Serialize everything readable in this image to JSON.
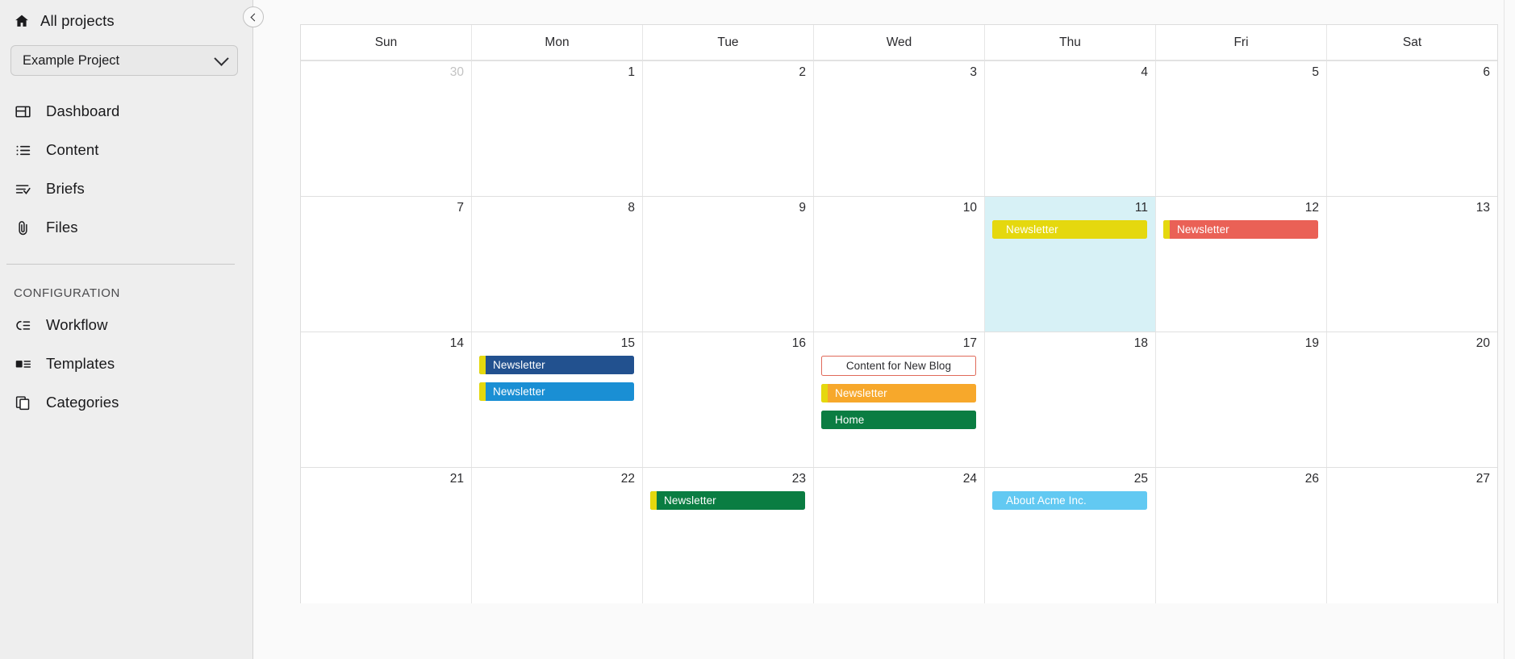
{
  "sidebar": {
    "all_projects": {
      "label": "All projects",
      "icon": "home-icon"
    },
    "project_selector": {
      "value": "Example Project",
      "icon": "chevron-down-icon"
    },
    "nav_items": [
      {
        "label": "Dashboard",
        "icon": "dashboard-icon"
      },
      {
        "label": "Content",
        "icon": "list-icon"
      },
      {
        "label": "Briefs",
        "icon": "briefs-icon"
      },
      {
        "label": "Files",
        "icon": "paperclip-icon"
      }
    ],
    "section_title": "CONFIGURATION",
    "config_items": [
      {
        "label": "Workflow",
        "icon": "workflow-icon"
      },
      {
        "label": "Templates",
        "icon": "templates-icon"
      },
      {
        "label": "Categories",
        "icon": "categories-icon"
      }
    ],
    "collapse_button": {
      "icon": "chevron-left-icon"
    }
  },
  "calendar": {
    "weekday_headers": [
      "Sun",
      "Mon",
      "Tue",
      "Wed",
      "Thu",
      "Fri",
      "Sat"
    ],
    "weeks": [
      {
        "days": [
          {
            "number": "30",
            "other_month": true,
            "today": false,
            "events": []
          },
          {
            "number": "1",
            "other_month": false,
            "today": false,
            "events": []
          },
          {
            "number": "2",
            "other_month": false,
            "today": false,
            "events": []
          },
          {
            "number": "3",
            "other_month": false,
            "today": false,
            "events": []
          },
          {
            "number": "4",
            "other_month": false,
            "today": false,
            "events": []
          },
          {
            "number": "5",
            "other_month": false,
            "today": false,
            "events": []
          },
          {
            "number": "6",
            "other_month": false,
            "today": false,
            "events": []
          }
        ]
      },
      {
        "days": [
          {
            "number": "7",
            "other_month": false,
            "today": false,
            "events": []
          },
          {
            "number": "8",
            "other_month": false,
            "today": false,
            "events": []
          },
          {
            "number": "9",
            "other_month": false,
            "today": false,
            "events": []
          },
          {
            "number": "10",
            "other_month": false,
            "today": false,
            "events": []
          },
          {
            "number": "11",
            "other_month": false,
            "today": true,
            "events": [
              {
                "title": "Newsletter",
                "style": "filled",
                "bg": "#e5d80e",
                "accent": null,
                "text": "#ffffff"
              }
            ]
          },
          {
            "number": "12",
            "other_month": false,
            "today": false,
            "events": [
              {
                "title": "Newsletter",
                "style": "filled",
                "bg": "#ea6156",
                "accent": "#e5d80e",
                "text": "#ffffff"
              }
            ]
          },
          {
            "number": "13",
            "other_month": false,
            "today": false,
            "events": []
          }
        ]
      },
      {
        "days": [
          {
            "number": "14",
            "other_month": false,
            "today": false,
            "events": []
          },
          {
            "number": "15",
            "other_month": false,
            "today": false,
            "events": [
              {
                "title": "Newsletter",
                "style": "filled",
                "bg": "#22518f",
                "accent": "#e5d80e",
                "text": "#ffffff"
              },
              {
                "title": "Newsletter",
                "style": "filled",
                "bg": "#1a8fd4",
                "accent": "#e5d80e",
                "text": "#ffffff"
              }
            ]
          },
          {
            "number": "16",
            "other_month": false,
            "today": false,
            "events": []
          },
          {
            "number": "17",
            "other_month": false,
            "today": false,
            "events": [
              {
                "title": "Content for New Blog",
                "style": "outlined",
                "bg": "#ffffff",
                "accent": null,
                "text": "#2b2b2e",
                "border": "#e06a5a"
              },
              {
                "title": "Newsletter",
                "style": "filled",
                "bg": "#f7a82b",
                "accent": "#e5d80e",
                "text": "#ffffff"
              },
              {
                "title": "Home",
                "style": "filled",
                "bg": "#0a7d42",
                "accent": null,
                "text": "#ffffff"
              }
            ]
          },
          {
            "number": "18",
            "other_month": false,
            "today": false,
            "events": []
          },
          {
            "number": "19",
            "other_month": false,
            "today": false,
            "events": []
          },
          {
            "number": "20",
            "other_month": false,
            "today": false,
            "events": []
          }
        ]
      },
      {
        "days": [
          {
            "number": "21",
            "other_month": false,
            "today": false,
            "events": []
          },
          {
            "number": "22",
            "other_month": false,
            "today": false,
            "events": []
          },
          {
            "number": "23",
            "other_month": false,
            "today": false,
            "events": [
              {
                "title": "Newsletter",
                "style": "filled",
                "bg": "#0a7d42",
                "accent": "#e5d80e",
                "text": "#ffffff"
              }
            ]
          },
          {
            "number": "24",
            "other_month": false,
            "today": false,
            "events": []
          },
          {
            "number": "25",
            "other_month": false,
            "today": false,
            "events": [
              {
                "title": "About Acme Inc.",
                "style": "filled",
                "bg": "#62c9f2",
                "accent": null,
                "text": "#ffffff"
              }
            ]
          },
          {
            "number": "26",
            "other_month": false,
            "today": false,
            "events": []
          },
          {
            "number": "27",
            "other_month": false,
            "today": false,
            "events": []
          }
        ]
      }
    ]
  },
  "colors": {
    "sidebar_bg": "#eeeeee",
    "today_bg": "#d7f1f6",
    "accent_yellow": "#e5d80e",
    "grid_line": "#e6e6e6"
  }
}
